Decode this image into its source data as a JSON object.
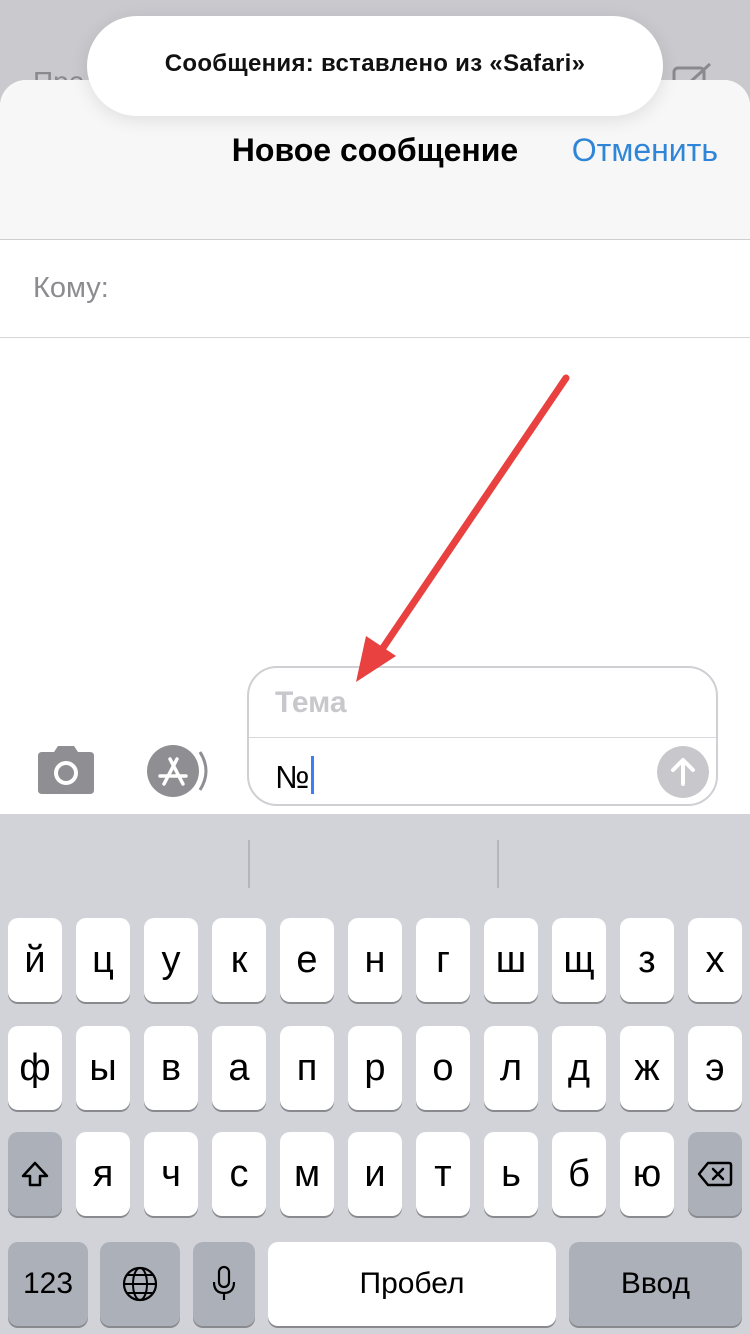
{
  "toast": {
    "text": "Сообщения: вставлено из «Safari»"
  },
  "background": {
    "list_partial_text": "Пре"
  },
  "header": {
    "title": "Новое сообщение",
    "cancel_label": "Отменить"
  },
  "recipient": {
    "label": "Кому:"
  },
  "compose": {
    "subject_placeholder": "Тема",
    "body_value": "№"
  },
  "annotation": {
    "arrow_color": "#e8413f"
  },
  "colors": {
    "accent": "#2f86d8",
    "keyboard_bg": "#d1d3d9",
    "send_disabled": "#c7c7cc"
  },
  "icons": {
    "camera": "camera-icon",
    "appstore": "app-store-icon",
    "send": "arrow-up-icon",
    "shift": "shift-icon",
    "backspace": "backspace-icon",
    "globe": "globe-icon",
    "mic": "microphone-icon",
    "compose": "compose-icon"
  },
  "keyboard": {
    "row1": [
      "й",
      "ц",
      "у",
      "к",
      "е",
      "н",
      "г",
      "ш",
      "щ",
      "з",
      "х"
    ],
    "row2": [
      "ф",
      "ы",
      "в",
      "а",
      "п",
      "р",
      "о",
      "л",
      "д",
      "ж",
      "э"
    ],
    "row3": [
      "я",
      "ч",
      "с",
      "м",
      "и",
      "т",
      "ь",
      "б",
      "ю"
    ],
    "numbers_label": "123",
    "space_label": "Пробел",
    "return_label": "Ввод"
  }
}
